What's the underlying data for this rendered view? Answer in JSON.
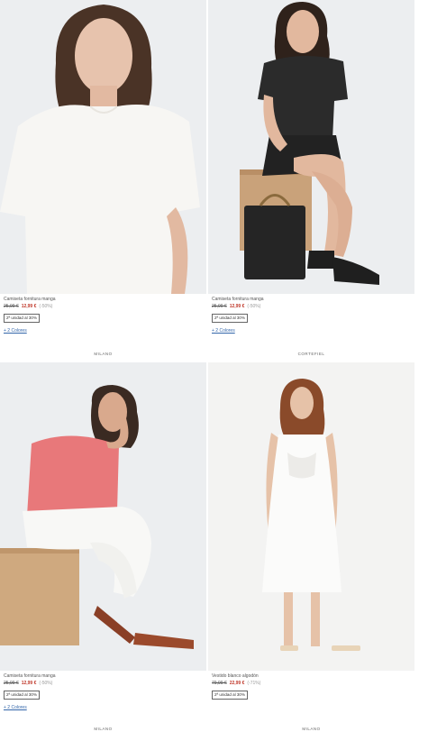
{
  "products": [
    {
      "name": "Camiseta fornitura manga",
      "old_price": "25,99 €",
      "new_price": "12,99 €",
      "discount": "(-50%)",
      "promo": "2ª unidad al 30%",
      "colors": "+ 2 Colores"
    },
    {
      "name": "Camiseta fornitura manga",
      "old_price": "25,99 €",
      "new_price": "12,99 €",
      "discount": "(-50%)",
      "promo": "2ª unidad al 30%",
      "colors": "+ 2 Colores"
    },
    {
      "name": "Camiseta fornitura manga",
      "old_price": "25,99 €",
      "new_price": "12,99 €",
      "discount": "(-50%)",
      "promo": "2ª unidad al 30%",
      "colors": "+ 2 Colores"
    },
    {
      "name": "Vestido blanco algodón",
      "old_price": "79,99 €",
      "new_price": "22,99 €",
      "discount": "(-71%)",
      "promo": "2ª unidad al 30%"
    }
  ],
  "brands": [
    "MILANO",
    "CORTEFIEL",
    "MILANO",
    "MILANO"
  ],
  "colors": {
    "sale_price": "#c0392b",
    "link": "#3366aa",
    "photo_bg_light": "#eceef0",
    "photo_bg_white": "#f3f3f2"
  }
}
